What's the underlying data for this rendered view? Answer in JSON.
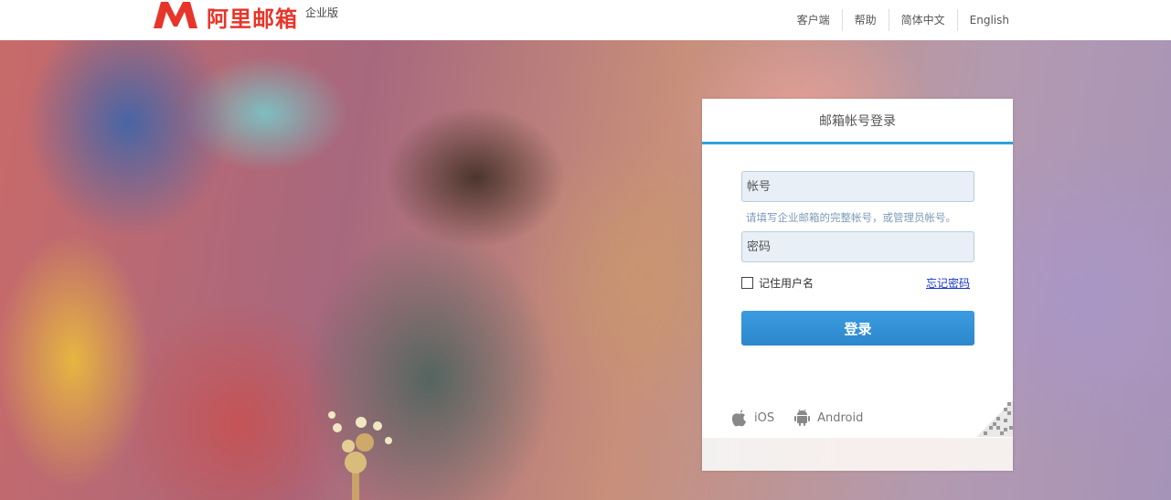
{
  "header": {
    "logo_text": "阿里邮箱",
    "logo_sub": "企业版",
    "nav": [
      "客户端",
      "帮助",
      "简体中文",
      "English"
    ]
  },
  "login": {
    "title": "邮箱帐号登录",
    "account_placeholder": "帐号",
    "account_hint": "请填写企业邮箱的完整帐号，或管理员帐号。",
    "password_placeholder": "密码",
    "remember_label": "记住用户名",
    "forgot_link": "忘记密码",
    "submit_label": "登录"
  },
  "apps": {
    "ios_label": "iOS",
    "android_label": "Android"
  },
  "colors": {
    "brand_red": "#e8352a",
    "accent_blue": "#2ea2de",
    "button_blue": "#3395dc",
    "link_blue": "#1a39c7"
  }
}
